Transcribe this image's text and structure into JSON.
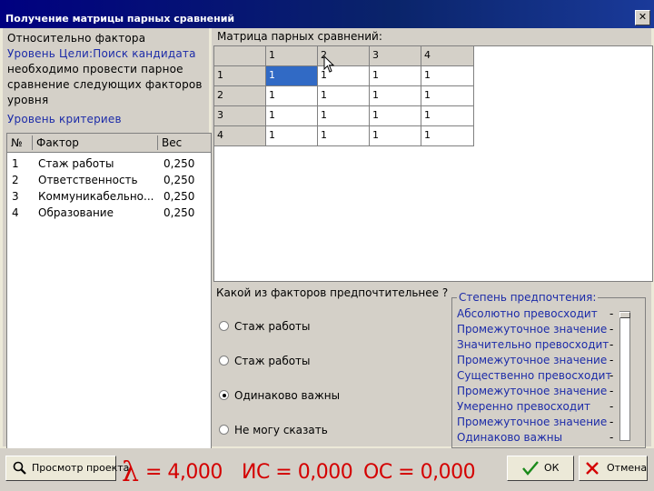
{
  "window": {
    "title": "Получение матрицы парных сравнений",
    "close_glyph": "✕"
  },
  "left": {
    "line1": "Относительно фактора",
    "line2": "Уровень Цели:Поиск кандидата",
    "line3": "необходимо провести парное",
    "line4": "сравнение следующих факторов",
    "line5": "уровня",
    "line6": "Уровень критериев"
  },
  "factor_table": {
    "headers": [
      "№",
      "Фактор",
      "Вес"
    ],
    "rows": [
      {
        "num": "1",
        "name": "Стаж работы",
        "weight": "0,250"
      },
      {
        "num": "2",
        "name": "Ответственность",
        "weight": "0,250"
      },
      {
        "num": "3",
        "name": "Коммуникабельно...",
        "weight": "0,250"
      },
      {
        "num": "4",
        "name": "Образование",
        "weight": "0,250"
      }
    ]
  },
  "matrix": {
    "caption": "Матрица парных сравнений:",
    "col_headers": [
      "1",
      "2",
      "3",
      "4"
    ],
    "row_headers": [
      "1",
      "2",
      "3",
      "4"
    ],
    "cells": [
      [
        "1",
        "1",
        "1",
        "1"
      ],
      [
        "1",
        "1",
        "1",
        "1"
      ],
      [
        "1",
        "1",
        "1",
        "1"
      ],
      [
        "1",
        "1",
        "1",
        "1"
      ]
    ],
    "selected": "1,1"
  },
  "question": "Какой из факторов предпочтительнее ?",
  "radios": [
    {
      "label": "Стаж работы",
      "checked": false
    },
    {
      "label": "Стаж работы",
      "checked": false
    },
    {
      "label": "Одинаково важны",
      "checked": true
    },
    {
      "label": "Не могу сказать",
      "checked": false
    }
  ],
  "preference": {
    "title": "Степень предпочтения:",
    "items": [
      "Абсолютно превосходит",
      "Промежуточное значение",
      "Значительно превосходит",
      "Промежуточное значение",
      "Существенно превосходит",
      "Промежуточное значение",
      "Умеренно превосходит",
      "Промежуточное значение",
      "Одинаково важны"
    ],
    "selected_level": 0
  },
  "buttons": {
    "preview": "Просмотр проекта",
    "ok": "ОК",
    "cancel": "Отмена"
  },
  "metrics": {
    "lambda_symbol": "λ",
    "lambda": "= 4,000",
    "ic": "ИС = 0,000",
    "oc": "ОС = 0,000"
  },
  "colors": {
    "accent_blue": "#1c2ba8",
    "metric_red": "#d40000",
    "selection": "#316ac5"
  }
}
